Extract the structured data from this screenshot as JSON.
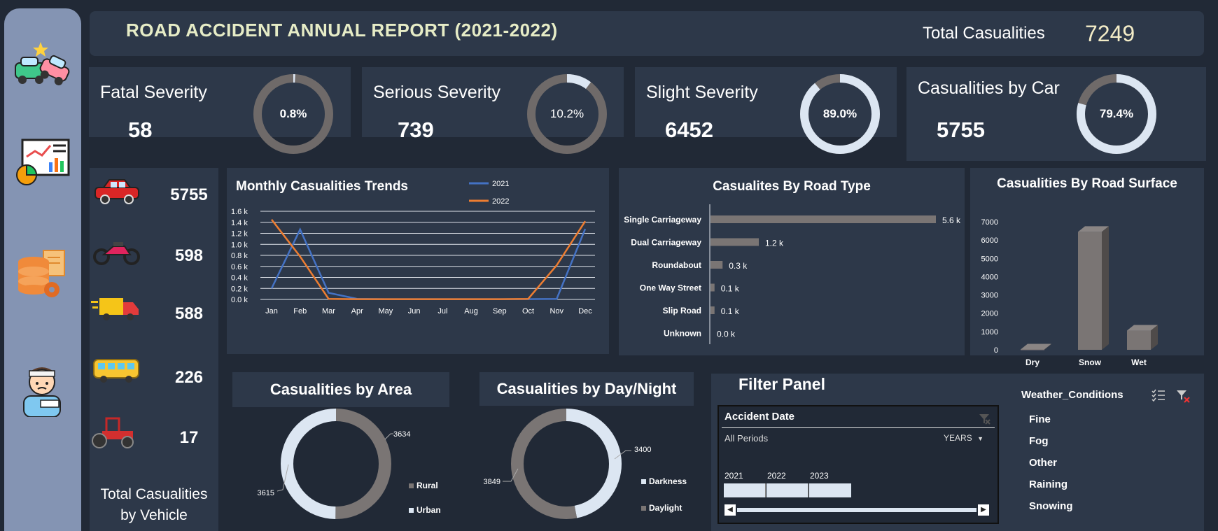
{
  "header": {
    "title": "ROAD  ACCIDENT ANNUAL  REPORT  (2021-2022)",
    "total_label": "Total Casualities",
    "total_value": "7249"
  },
  "kpis": [
    {
      "label": "Fatal Severity",
      "value": "58",
      "pct_label": "0.8%",
      "pct": 0.8
    },
    {
      "label": "Serious Severity",
      "value": "739",
      "pct_label": "10.2%",
      "pct": 10.2
    },
    {
      "label": "Slight Severity",
      "value": "6452",
      "pct_label": "89.0%",
      "pct": 89.0
    },
    {
      "label": "Casualities by Car",
      "value": "5755",
      "pct_label": "79.4%",
      "pct": 79.4
    }
  ],
  "vehicles": {
    "items": [
      {
        "icon": "car-icon",
        "value": "5755"
      },
      {
        "icon": "motorcycle-icon",
        "value": "598"
      },
      {
        "icon": "truck-icon",
        "value": "588"
      },
      {
        "icon": "bus-icon",
        "value": "226"
      },
      {
        "icon": "tractor-icon",
        "value": "17"
      }
    ],
    "caption_line1": "Total Casualities",
    "caption_line2": "by Vehicle"
  },
  "sidebar": {
    "icons": [
      "car-crash-icon",
      "analytics-report-icon",
      "database-settings-icon",
      "injured-person-icon"
    ]
  },
  "colors": {
    "bg": "#212936",
    "panel": "#2d3849",
    "sidebar": "#8494b3",
    "series_2021": "#4472c4",
    "series_2022": "#ed7d31",
    "gray_mark": "#7a7574",
    "light_mark": "#dce6f2"
  },
  "monthly": {
    "title": "Monthly Casualities Trends",
    "yticks": [
      "0.0 k",
      "0.2 k",
      "0.4 k",
      "0.6 k",
      "0.8 k",
      "1.0 k",
      "1.2 k",
      "1.4 k",
      "1.6 k"
    ]
  },
  "road_type": {
    "title": "Casualites By Road Type"
  },
  "road_surface": {
    "title": "Casualities By Road Surface",
    "yticks": [
      "0",
      "1000",
      "2000",
      "3000",
      "4000",
      "5000",
      "6000",
      "7000"
    ]
  },
  "area": {
    "title": "Casualities by Area"
  },
  "daynight": {
    "title": "Casualities by Day/Night"
  },
  "filter": {
    "title": "Filter Panel",
    "timeline_title": "Accident Date",
    "all_periods": "All Periods",
    "period_unit": "YEARS",
    "years": [
      "2021",
      "2022",
      "2023"
    ],
    "slicer_title": "Weather_Conditions",
    "weather": [
      "Fine",
      "Fog",
      "Other",
      "Raining",
      "Snowing"
    ]
  },
  "chart_data": [
    {
      "type": "line",
      "title": "Monthly Casualities Trends",
      "x": [
        "Jan",
        "Feb",
        "Mar",
        "Apr",
        "May",
        "Jun",
        "Jul",
        "Aug",
        "Sep",
        "Oct",
        "Nov",
        "Dec"
      ],
      "ylim": [
        0,
        1600
      ],
      "series": [
        {
          "name": "2021",
          "values": [
            200,
            1270,
            120,
            10,
            5,
            5,
            5,
            5,
            5,
            5,
            10,
            1280
          ]
        },
        {
          "name": "2022",
          "values": [
            1450,
            780,
            10,
            5,
            5,
            5,
            5,
            5,
            5,
            10,
            620,
            1420
          ]
        }
      ],
      "legend": "top"
    },
    {
      "type": "bar",
      "orientation": "horizontal",
      "title": "Casualites By Road Type",
      "categories": [
        "Single Carriageway",
        "Dual Carriageway",
        "Roundabout",
        "One Way Street",
        "Slip Road",
        "Unknown"
      ],
      "values": [
        5.6,
        1.2,
        0.3,
        0.1,
        0.1,
        0.0
      ],
      "value_labels": [
        "5.6 k",
        "1.2 k",
        "0.3 k",
        "0.1 k",
        "0.1 k",
        "0.0 k"
      ],
      "unit": "k"
    },
    {
      "type": "bar",
      "title": "Casualities By Road Surface",
      "categories": [
        "Dry",
        "Snow",
        "Wet"
      ],
      "values": [
        20,
        6450,
        1050
      ],
      "ylim": [
        0,
        7000
      ]
    },
    {
      "type": "pie",
      "title": "Casualities by Area",
      "categories": [
        "Rural",
        "Urban"
      ],
      "values": [
        3634,
        3615
      ],
      "value_labels": [
        "3634",
        "3615"
      ]
    },
    {
      "type": "pie",
      "title": "Casualities by Day/Night",
      "categories": [
        "Darkness",
        "Daylight"
      ],
      "values": [
        3400,
        3849
      ],
      "value_labels": [
        "3400",
        "3849"
      ]
    }
  ]
}
